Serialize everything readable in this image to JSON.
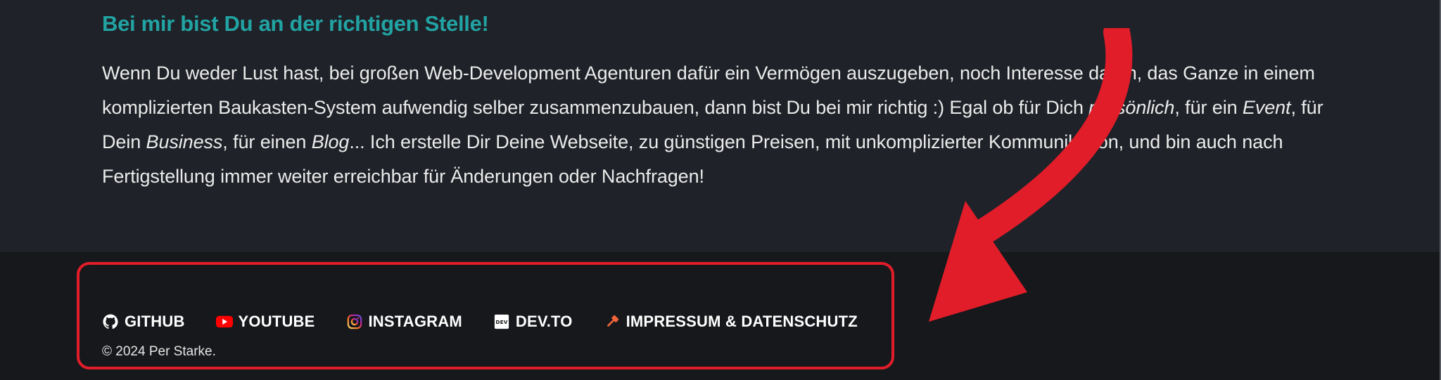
{
  "section": {
    "heading": "Bei mir bist Du an der richtigen Stelle!",
    "paragraph": {
      "p1": "Wenn Du weder Lust hast, bei großen Web-Development Agenturen dafür ein Vermögen auszugeben, noch Interesse daran, das Ganze in einem komplizierten Baukasten-System aufwendig selber zusammenzubauen, dann bist Du bei mir richtig :) Egal ob für Dich ",
      "e1": "persönlich",
      "p2": ", für ein ",
      "e2": "Event",
      "p3": ", für Dein ",
      "e3": "Business",
      "p4": ", für einen ",
      "e4": "Blog",
      "p5": "... Ich erstelle Dir Deine Webseite, zu günstigen Preisen, mit unkomplizierter Kommunikation, und bin auch nach Fertigstellung immer weiter erreichbar für Änderungen oder Nachfragen!"
    }
  },
  "footer": {
    "links": [
      {
        "label": "GITHUB",
        "icon": "github-icon"
      },
      {
        "label": "YOUTUBE",
        "icon": "youtube-icon"
      },
      {
        "label": "INSTAGRAM",
        "icon": "instagram-icon"
      },
      {
        "label": "DEV.TO",
        "icon": "devto-icon"
      },
      {
        "label": "IMPRESSUM & DATENSCHUTZ",
        "icon": "gavel-icon"
      }
    ],
    "copyright": "© 2024 Per Starke."
  },
  "colors": {
    "heading": "#22a3a3",
    "annotation": "#e11d2a",
    "footer_bg": "#17181b",
    "content_bg": "#1f2228"
  }
}
